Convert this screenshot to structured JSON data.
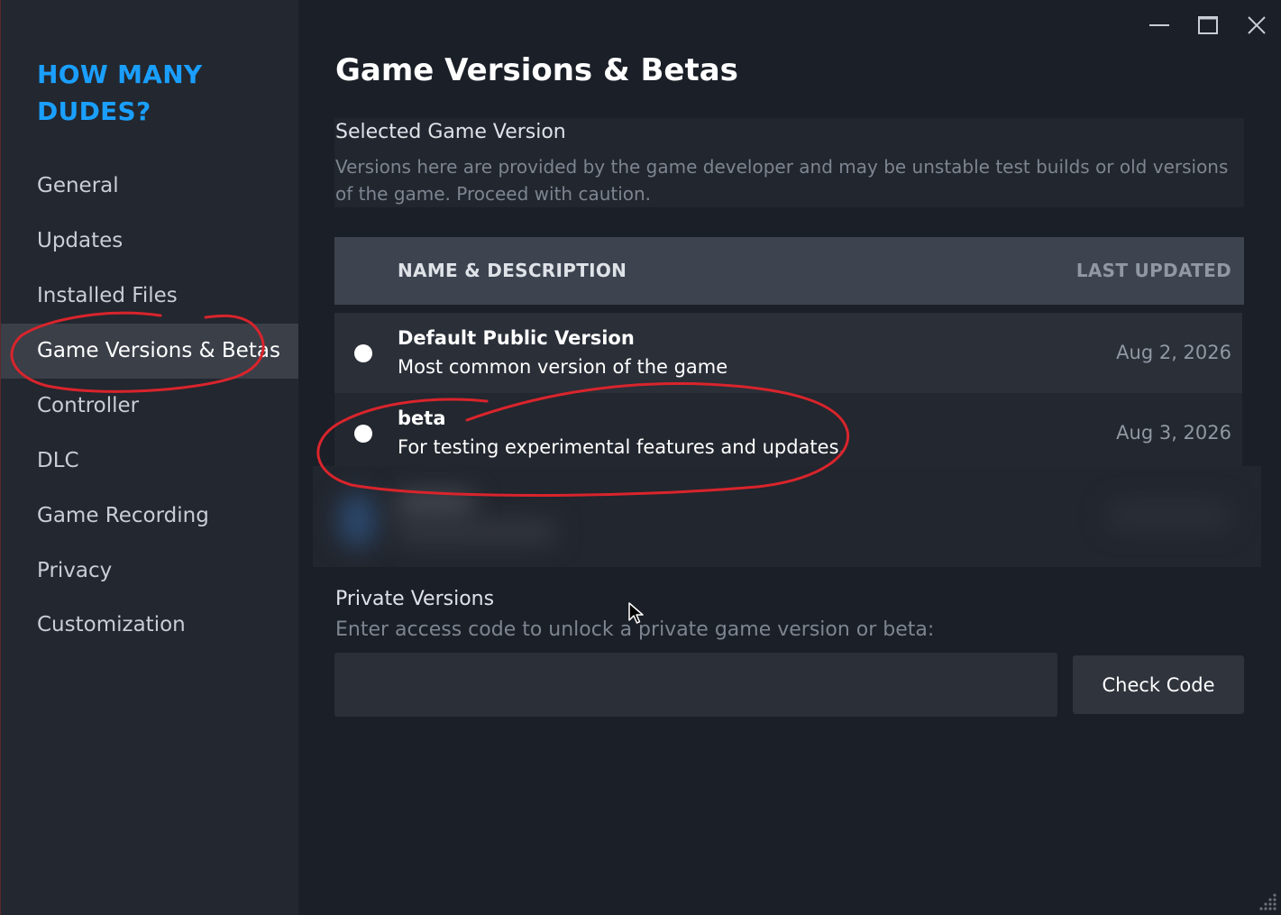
{
  "sidebar": {
    "game_title": "HOW MANY DUDES?",
    "items": [
      {
        "label": "General"
      },
      {
        "label": "Updates"
      },
      {
        "label": "Installed Files"
      },
      {
        "label": "Game Versions & Betas"
      },
      {
        "label": "Controller"
      },
      {
        "label": "DLC"
      },
      {
        "label": "Game Recording"
      },
      {
        "label": "Privacy"
      },
      {
        "label": "Customization"
      }
    ],
    "active_item": "Game Versions & Betas"
  },
  "window_controls": {
    "icons": [
      "minimize-icon",
      "maximize-icon",
      "close-icon"
    ]
  },
  "main": {
    "title": "Game Versions & Betas",
    "selected_version": {
      "heading": "Selected Game Version",
      "description": "Versions here are provided by the game developer and may be unstable test builds or old versions of the game. Proceed with caution."
    },
    "table": {
      "columns": [
        "NAME & DESCRIPTION",
        "LAST UPDATED"
      ],
      "rows": [
        {
          "name": "Default Public Version",
          "description": "Most common version of the game",
          "last_updated": "Aug 2, 2026"
        },
        {
          "name": "beta",
          "description": "For testing experimental features and updates.",
          "last_updated": "Aug 3, 2026"
        }
      ]
    },
    "private_versions": {
      "heading": "Private Versions",
      "description": "Enter access code to unlock a private game version or beta:",
      "input_value": "",
      "button_label": "Check Code"
    }
  },
  "colors": {
    "accent": "#1a9fff",
    "annotation": "#d9242c"
  }
}
